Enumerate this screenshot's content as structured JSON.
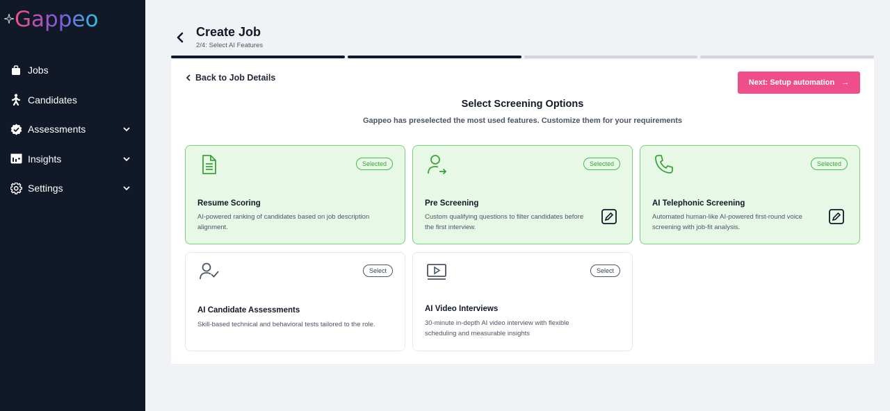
{
  "app": {
    "logo_text": "Gappeo"
  },
  "sidebar": {
    "items": [
      {
        "label": "Jobs",
        "icon": "briefcase-icon",
        "expandable": false
      },
      {
        "label": "Candidates",
        "icon": "person-walking-icon",
        "expandable": false
      },
      {
        "label": "Assessments",
        "icon": "badge-check-icon",
        "expandable": true
      },
      {
        "label": "Insights",
        "icon": "dashboard-icon",
        "expandable": true
      },
      {
        "label": "Settings",
        "icon": "gear-icon",
        "expandable": true
      }
    ]
  },
  "header": {
    "title": "Create Job",
    "subtitle": "2/4: Select AI Features",
    "steps_total": 4,
    "steps_complete": 2
  },
  "panel": {
    "back_link": "Back to Job Details",
    "next_button": "Next: Setup automation",
    "next_arrow": "→",
    "title": "Select Screening Options",
    "subtitle": "Gappeo has preselected the most used features. Customize them for your requirements"
  },
  "cards": [
    {
      "title": "Resume Scoring",
      "description": "AI-powered ranking of candidates based on job description alignment.",
      "badge": "Selected",
      "selected": true,
      "icon": "document-icon",
      "editable": false
    },
    {
      "title": "Pre Screening",
      "description": "Custom qualifying questions to filter candidates before the first interview.",
      "badge": "Selected",
      "selected": true,
      "icon": "user-forward-icon",
      "editable": true
    },
    {
      "title": "AI Telephonic Screening",
      "description": "Automated human-like AI-powered first-round voice screening with job-fit analysis.",
      "badge": "Selected",
      "selected": true,
      "icon": "phone-icon",
      "editable": true
    },
    {
      "title": "AI Candidate Assessments",
      "description": "Skill-based technical and behavioral tests tailored to the role.",
      "badge": "Select",
      "selected": false,
      "icon": "user-check-icon",
      "editable": false
    },
    {
      "title": "AI Video Interviews",
      "description": "30-minute in-depth AI video interview with flexible scheduling and measurable insights",
      "badge": "Select",
      "selected": false,
      "icon": "video-icon",
      "editable": false
    }
  ],
  "colors": {
    "sidebar_bg": "#111827",
    "accent": "#ee4f8a",
    "selected_bg": "#e7f8e7",
    "selected_border": "#7ad17a",
    "logo_gradient": [
      "#ee4f8a",
      "#7b5cd6",
      "#2ec4e6"
    ]
  }
}
